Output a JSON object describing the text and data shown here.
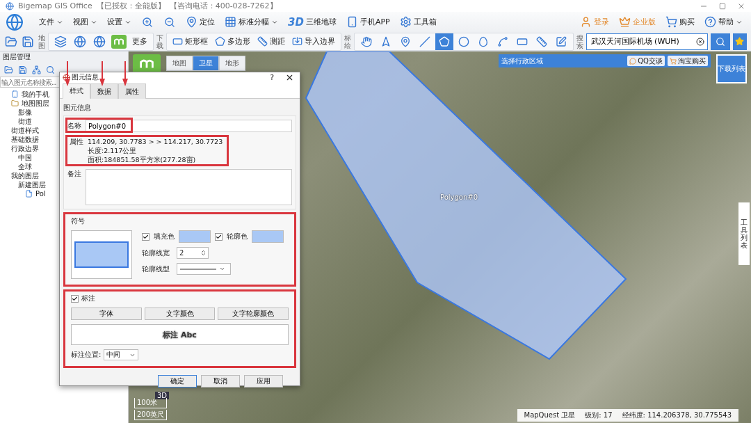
{
  "window": {
    "title": [
      "Bigemap GIS Office",
      "【已授权：全能版】",
      "【咨询电话：400-028-7262】"
    ]
  },
  "menubar": {
    "items": [
      {
        "kind": "menu",
        "label": "文件",
        "dropdown": true
      },
      {
        "kind": "menu",
        "label": "视图",
        "dropdown": true
      },
      {
        "kind": "menu",
        "label": "设置",
        "dropdown": true
      },
      {
        "kind": "zoom-in"
      },
      {
        "kind": "zoom-out"
      },
      {
        "kind": "locate",
        "label": "定位",
        "dropdown": false
      },
      {
        "kind": "grid",
        "label": "标准分幅",
        "dropdown": true
      },
      {
        "kind": "globe",
        "badge": "3D",
        "label": "三维地球",
        "dropdown": false
      },
      {
        "kind": "phone",
        "label": "手机APP",
        "dropdown": false
      },
      {
        "kind": "gear",
        "label": "工具箱",
        "dropdown": false
      }
    ],
    "account": [
      {
        "kind": "user",
        "label": "登录",
        "dropdown": false
      },
      {
        "kind": "crown",
        "label": "企业版",
        "dropdown": false
      },
      {
        "kind": "buy",
        "label": "购买",
        "dropdown": false
      },
      {
        "kind": "help",
        "label": "帮助",
        "dropdown": true
      }
    ]
  },
  "toolbar": {
    "file": [
      {
        "kind": "open"
      },
      {
        "kind": "save"
      }
    ],
    "map_group": {
      "label": "地图",
      "items": [
        {
          "kind": "layers"
        },
        {
          "kind": "globe"
        },
        {
          "kind": "globe"
        },
        {
          "kind": "m"
        }
      ],
      "more": "更多"
    },
    "download_group": {
      "label": "下载",
      "items": [
        {
          "kind": "rect",
          "label": "矩形框"
        },
        {
          "kind": "polygon",
          "label": "多边形"
        },
        {
          "kind": "ruler",
          "label": "测距"
        },
        {
          "kind": "import",
          "label": "导入边界"
        }
      ]
    },
    "plot_group": {
      "label": "标绘",
      "items": [
        {
          "kind": "hand",
          "selected": false
        },
        {
          "kind": "pointer",
          "selected": false
        },
        {
          "kind": "pin",
          "selected": false
        },
        {
          "kind": "line",
          "selected": false
        },
        {
          "kind": "polyline",
          "selected": true
        },
        {
          "kind": "circle",
          "selected": false
        },
        {
          "kind": "ellipse",
          "selected": false
        },
        {
          "kind": "curve",
          "selected": false
        },
        {
          "kind": "rect",
          "selected": false
        },
        {
          "kind": "ruler",
          "selected": false
        },
        {
          "kind": "edit",
          "selected": false
        }
      ]
    },
    "search": {
      "label": "搜索",
      "value": "武汉天河国际机场 (WUH)"
    }
  },
  "layer_panel": {
    "title": "图层管理",
    "tools": [
      {
        "kind": "open"
      },
      {
        "kind": "save"
      },
      {
        "kind": "network"
      },
      {
        "kind": "search"
      }
    ],
    "search": {
      "placeholder": "输入图元名称搜索..."
    },
    "tree": [
      {
        "kind": "phone",
        "label": "我的手机"
      },
      {
        "kind": "folder",
        "label": "地图图层",
        "children": [
          {
            "label": "影像"
          },
          {
            "label": "街道"
          }
        ]
      },
      {
        "label": "街道样式"
      },
      {
        "label": "基础数据"
      },
      {
        "label": "行政边界",
        "children": [
          {
            "label": "中国"
          },
          {
            "label": "全球"
          }
        ]
      },
      {
        "label": "我的图层",
        "children": [
          {
            "label": "新建图层",
            "children": [
              {
                "kind": "doc",
                "label": "Pol"
              }
            ]
          }
        ]
      }
    ]
  },
  "map": {
    "tabs": [
      {
        "label": "地图",
        "selected": false
      },
      {
        "label": "卫星",
        "selected": true
      },
      {
        "label": "地形",
        "selected": false
      }
    ],
    "region_bar": {
      "label": "选择行政区域",
      "buttons": [
        {
          "kind": "qq",
          "label": "QQ交谈"
        },
        {
          "kind": "shop",
          "label": "淘宝购买"
        }
      ]
    },
    "download_list": "下载列表",
    "side_tab": "工具列表",
    "polygon_label": "Polygon#0",
    "scale": [
      "100米",
      "200英尺"
    ],
    "mode_badge": "3D",
    "status": [
      "MapQuest 卫星",
      "级别:  17",
      "经纬度:  114.206378, 30.775543"
    ]
  },
  "dialog": {
    "title": "图元信息",
    "help": "?",
    "tabs": [
      {
        "label": "样式",
        "selected": true
      },
      {
        "label": "数据",
        "selected": false
      },
      {
        "label": "属性",
        "selected": false
      }
    ],
    "section": "图元信息",
    "name": {
      "label": "名称",
      "value": "Polygon#0"
    },
    "attributes": {
      "label": "属性",
      "lines": [
        "114.209, 30.7783  >  > 114.217, 30.7723",
        "长度:2.117公里",
        "面积:184851.58平方米(277.28亩)"
      ]
    },
    "note": {
      "label": "备注"
    },
    "symbol": {
      "title": "符号",
      "fill": {
        "label": "填充色",
        "checked": true,
        "color": "#a9c8f5"
      },
      "outline": {
        "label": "轮廓色",
        "checked": true,
        "color": "#a9c8f5"
      },
      "width": {
        "label": "轮廓线宽",
        "value": "2"
      },
      "style": {
        "label": "轮廓线型"
      }
    },
    "annotation": {
      "title": "标注",
      "checked": true,
      "buttons": [
        "字体",
        "文字颜色",
        "文字轮廓颜色"
      ],
      "preview": "标注 Abc",
      "position": {
        "label": "标注位置:",
        "value": "中间"
      }
    },
    "buttons": [
      {
        "label": "确定",
        "default": true
      },
      {
        "label": "取消",
        "default": false
      },
      {
        "label": "应用",
        "default": false
      }
    ]
  }
}
